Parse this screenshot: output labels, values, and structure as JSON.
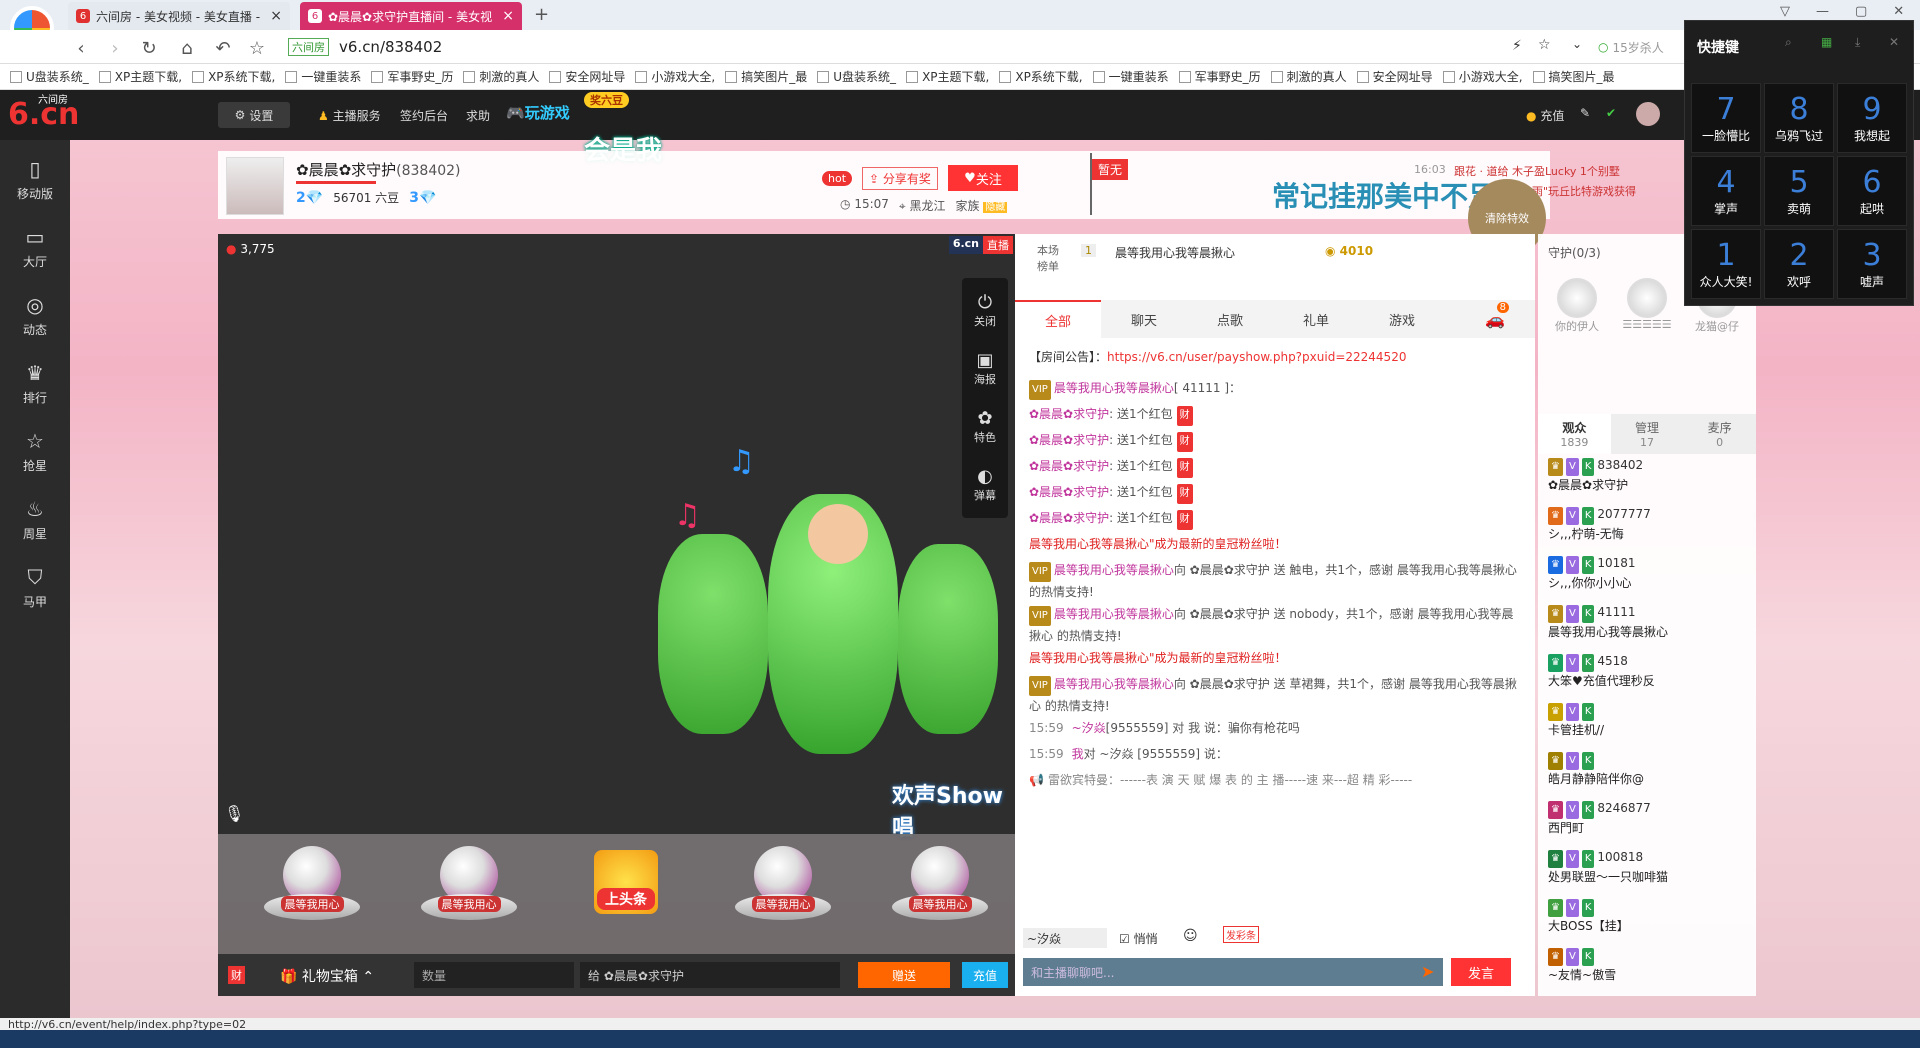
{
  "browser": {
    "tabs": [
      {
        "label": "六间房 - 美女视频 - 美女直播 -",
        "active": false
      },
      {
        "label": "✿晨晨✿求守护直播间 - 美女视",
        "active": true
      }
    ],
    "address": {
      "site_tag": "六间房",
      "url": "v6.cn/838402"
    },
    "search_placeholder": "15岁杀人",
    "bookmarks": [
      "U盘装系统_",
      "XP主题下载,",
      "XP系统下载,",
      "一键重装系",
      "军事野史_历",
      "刺激的真人",
      "安全网址导",
      "小游戏大全,",
      "搞笑图片_最",
      "U盘装系统_",
      "XP主题下载,",
      "XP系统下载,",
      "一键重装系",
      "军事野史_历",
      "刺激的真人",
      "安全网址导",
      "小游戏大全,",
      "搞笑图片_最"
    ],
    "status_url": "http://v6.cn/event/help/index.php?type=02"
  },
  "site": {
    "logo": "6.cn",
    "logo_sub": "六间房",
    "nav": {
      "settings": "设置",
      "anchor_service": "主播服务",
      "sign_backend": "签约后台",
      "help": "求助",
      "play_games": "玩游戏",
      "sticker": "奖六豆",
      "recharge": "充值"
    },
    "left_nav": [
      {
        "label": "移动版",
        "icon": "phone-icon"
      },
      {
        "label": "大厅",
        "icon": "tv-icon"
      },
      {
        "label": "动态",
        "icon": "compass-icon"
      },
      {
        "label": "排行",
        "icon": "crown-icon"
      },
      {
        "label": "抢星",
        "icon": "star-icon"
      },
      {
        "label": "周星",
        "icon": "cup-icon"
      },
      {
        "label": "马甲",
        "icon": "shirt-icon"
      }
    ],
    "floating_text": "会是我"
  },
  "room": {
    "anchor_name": "✿晨晨✿求守护",
    "room_id": "(838402)",
    "level": "2",
    "beans": "56701 六豆",
    "level2": "3",
    "hot": "hot",
    "share": "分享有奖",
    "follow": "关注",
    "time": "15:07",
    "location": "黑龙江",
    "family_label": "家族",
    "family_tag": "隐藏",
    "flag": "暂无",
    "banner": "常记挂那美中不足",
    "clear_effect": "清除特效",
    "ticker_time": "16:03",
    "ticker_text": "跟花 · 道给 木子盈Lucky 1个别墅",
    "ticker_text2": "一心雨\"玩丘比特游戏获得"
  },
  "video": {
    "viewer_count": "3,775",
    "brand": "6.cn",
    "live": "直播",
    "controls": [
      {
        "label": "关闭",
        "icon": "power-icon"
      },
      {
        "label": "海报",
        "icon": "poster-icon"
      },
      {
        "label": "特色",
        "icon": "feature-icon"
      },
      {
        "label": "弹幕",
        "icon": "toggle-icon",
        "toggle": "OFF"
      }
    ],
    "watermark": "欢声Show唱"
  },
  "gifts": [
    {
      "label": "晨等我用心",
      "type": "plate"
    },
    {
      "label": "晨等我用心",
      "type": "plate"
    },
    {
      "label": "上头条",
      "type": "headline"
    },
    {
      "label": "晨等我用心",
      "type": "plate"
    },
    {
      "label": "晨等我用心",
      "type": "plate"
    }
  ],
  "bottom_bar": {
    "rich": "财",
    "treasure": "礼物宝箱",
    "quantity_placeholder": "数量",
    "to_label": "给",
    "to_user": "✿晨晨✿求守护",
    "send": "赠送",
    "recharge": "充值"
  },
  "chat": {
    "rank_label": "本场\n榜单",
    "rank_num": "1",
    "rank_user": "晨等我用心我等晨揪心",
    "rank_score": "4010",
    "tabs": [
      "全部",
      "聊天",
      "点歌",
      "礼单",
      "游戏"
    ],
    "car_badge": "8",
    "announce_label": "【房间公告】：",
    "announce_url": "https://v6.cn/user/payshow.php?pxuid=22244520",
    "messages": [
      {
        "user": "晨等我用心我等晨揪心",
        "text": "[ 41111 ]：",
        "type": "user"
      },
      {
        "user": "✿晨晨✿求守护",
        "text": ": 送1个红包",
        "type": "redpack"
      },
      {
        "user": "✿晨晨✿求守护",
        "text": ": 送1个红包",
        "type": "redpack"
      },
      {
        "user": "✿晨晨✿求守护",
        "text": ": 送1个红包",
        "type": "redpack"
      },
      {
        "user": "✿晨晨✿求守护",
        "text": ": 送1个红包",
        "type": "redpack"
      },
      {
        "user": "✿晨晨✿求守护",
        "text": ": 送1个红包",
        "type": "redpack"
      },
      {
        "user": "",
        "text": "晨等我用心我等晨揪心\"成为最新的皇冠粉丝啦！",
        "type": "system"
      },
      {
        "user": "晨等我用心我等晨揪心",
        "text": "向 ✿晨晨✿求守护 送  触电，共1个，感谢 晨等我用心我等晨揪心 的热情支持!",
        "type": "gift"
      },
      {
        "user": "晨等我用心我等晨揪心",
        "text": "向 ✿晨晨✿求守护 送  nobody，共1个，感谢 晨等我用心我等晨揪心 的热情支持!",
        "type": "gift"
      },
      {
        "user": "",
        "text": "晨等我用心我等晨揪心\"成为最新的皇冠粉丝啦！",
        "type": "system"
      },
      {
        "user": "晨等我用心我等晨揪心",
        "text": "向 ✿晨晨✿求守护 送  草裙舞，共1个，感谢 晨等我用心我等晨揪心 的热情支持!",
        "type": "gift"
      },
      {
        "time": "15:59",
        "user": "~汐焱",
        "text": "[9555559] 对 我 说：骗你有枪花吗",
        "type": "private"
      },
      {
        "time": "15:59",
        "user": "我",
        "text": "对 ~汐焱 [9555559] 说：",
        "type": "private"
      },
      {
        "user": "雷欲宾特曼",
        "text": "：------表 演 天 赋 爆 表 的 主 播-----速 来---超 精 彩-----",
        "type": "broadcast"
      }
    ],
    "input_to": "~汐焱",
    "whisper": "悄悄",
    "input_placeholder": "和主播聊聊吧...",
    "send": "发言",
    "ribbon": "发彩条"
  },
  "side": {
    "guard_label": "守护(0/3)",
    "guards": [
      "你的伊人",
      "☰☰☰☰☰",
      "龙猫@仔"
    ],
    "tabs": [
      {
        "label": "观众",
        "count": "1839"
      },
      {
        "label": "管理",
        "count": "17"
      },
      {
        "label": "麦序",
        "count": "0"
      }
    ],
    "audience": [
      {
        "id": "838402",
        "name": "✿晨晨✿求守护"
      },
      {
        "id": "2077777",
        "name": "シ,,,柠萌-无悔"
      },
      {
        "id": "10181",
        "name": "シ,,,你你小小心"
      },
      {
        "id": "41111",
        "name": "晨等我用心我等晨揪心"
      },
      {
        "id": "4518",
        "name": "大笨♥充值代理秒反"
      },
      {
        "id": "",
        "name": "卡管挂机//"
      },
      {
        "id": "",
        "name": "皓月静静陪伴你@"
      },
      {
        "id": "8246877",
        "name": "西門町"
      },
      {
        "id": "100818",
        "name": "处男联盟～一只咖啡猫"
      },
      {
        "id": "",
        "name": "大BOSS【挂】"
      },
      {
        "id": "",
        "name": "~友情~傲雪"
      }
    ]
  },
  "quick_keys": {
    "title": "快捷键",
    "keys": [
      {
        "num": "7",
        "label": "一脸懵比"
      },
      {
        "num": "8",
        "label": "乌鸦飞过"
      },
      {
        "num": "9",
        "label": "我想起"
      },
      {
        "num": "4",
        "label": "掌声"
      },
      {
        "num": "5",
        "label": "卖萌"
      },
      {
        "num": "6",
        "label": "起哄"
      },
      {
        "num": "1",
        "label": "众人大笑!"
      },
      {
        "num": "2",
        "label": "欢呼"
      },
      {
        "num": "3",
        "label": "嘘声"
      }
    ]
  }
}
